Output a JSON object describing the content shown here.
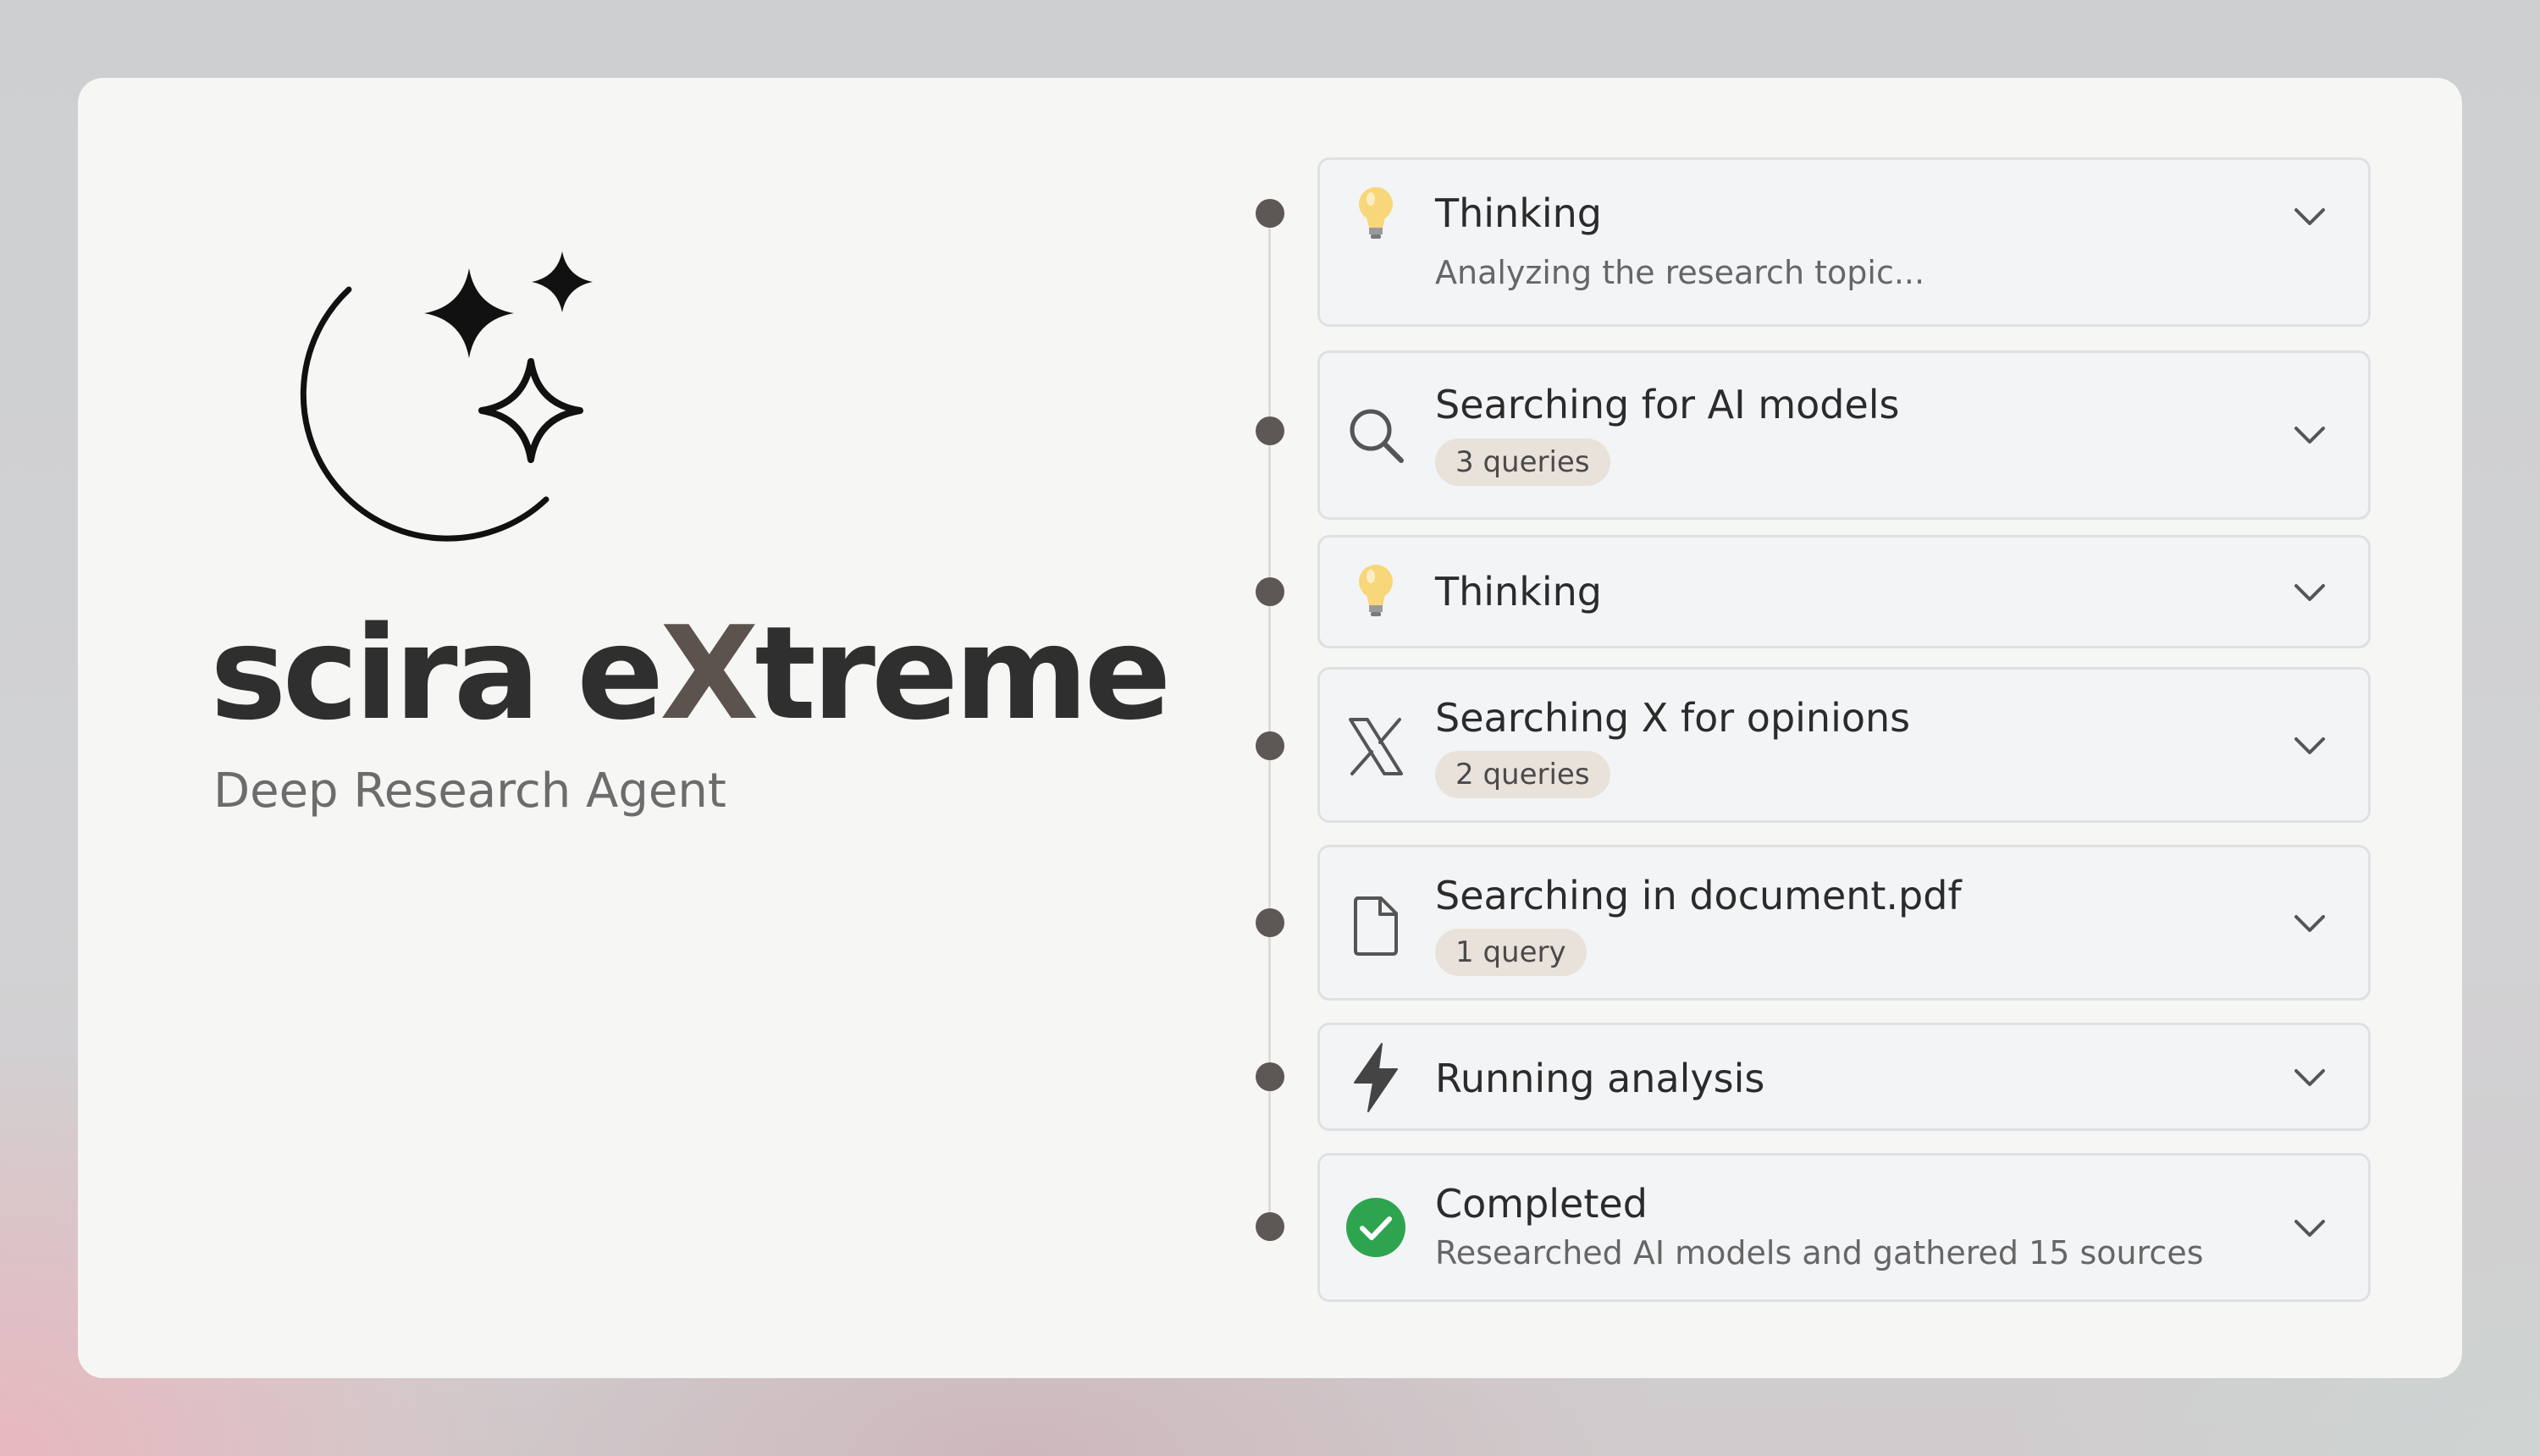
{
  "brand": {
    "name_prefix": "scira e",
    "name_accent": "X",
    "name_suffix": "treme",
    "tagline": "Deep Research Agent"
  },
  "steps": [
    {
      "icon": "lightbulb-icon",
      "title": "Thinking",
      "subtitle": "Analyzing the research topic...",
      "badge": null
    },
    {
      "icon": "search-icon",
      "title": "Searching for AI models",
      "subtitle": null,
      "badge": "3 queries"
    },
    {
      "icon": "lightbulb-icon",
      "title": "Thinking",
      "subtitle": null,
      "badge": null
    },
    {
      "icon": "x-logo-icon",
      "title": "Searching X for opinions",
      "subtitle": null,
      "badge": "2 queries"
    },
    {
      "icon": "document-icon",
      "title": "Searching in document.pdf",
      "subtitle": null,
      "badge": "1 query"
    },
    {
      "icon": "lightning-icon",
      "title": "Running analysis",
      "subtitle": null,
      "badge": null
    },
    {
      "icon": "check-circle-icon",
      "title": "Completed",
      "subtitle": "Researched AI models and gathered 15 sources",
      "badge": null
    }
  ],
  "colors": {
    "card_background": "#f6f6f5",
    "step_background": "#f3f4f6",
    "badge_background": "#e8e2da",
    "timeline_dot": "#5d5755",
    "success_green": "#2ea44f",
    "bulb_yellow": "#f7d77a"
  }
}
